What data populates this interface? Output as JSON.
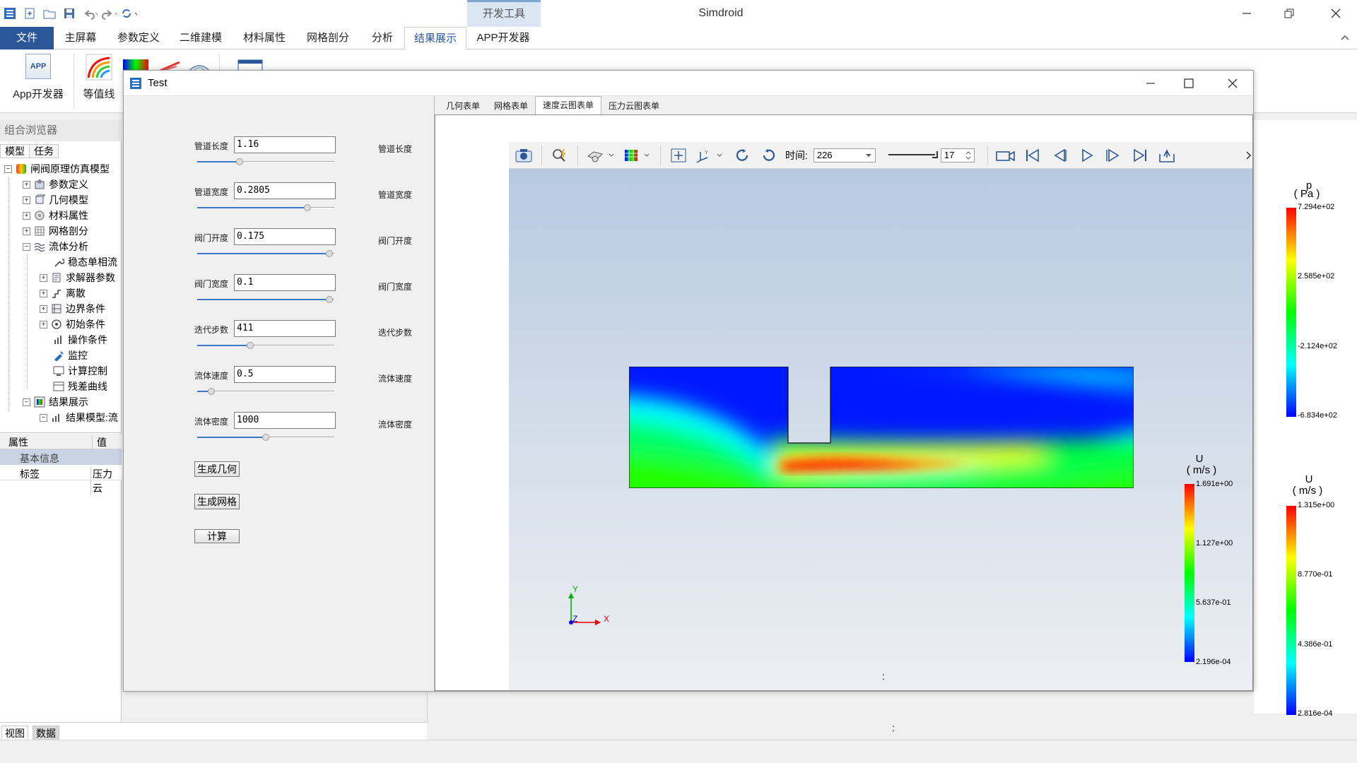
{
  "app": {
    "title": "Simdroid",
    "context_tab": "开发工具"
  },
  "ribbon": {
    "tabs": [
      "文件",
      "主屏幕",
      "参数定义",
      "二维建模",
      "材料属性",
      "网格剖分",
      "分析",
      "结果展示",
      "APP开发器"
    ],
    "active_tab": "结果展示",
    "buttons": {
      "app_dev": "App开发器",
      "contour": "等值线",
      "app_icon_text": "APP"
    }
  },
  "left_panel": {
    "header": "组合浏览器",
    "tabs": [
      "模型",
      "任务"
    ],
    "tree": [
      {
        "label": "闸阀原理仿真模型",
        "icon": "model-icon"
      },
      {
        "label": "参数定义",
        "icon": "parameter-icon"
      },
      {
        "label": "几何模型",
        "icon": "geometry-icon"
      },
      {
        "label": "材料属性",
        "icon": "material-icon"
      },
      {
        "label": "网格剖分",
        "icon": "mesh-icon"
      },
      {
        "label": "流体分析",
        "icon": "fluid-icon"
      },
      {
        "label": "稳态单相流",
        "icon": "wrench-icon"
      },
      {
        "label": "求解器参数",
        "icon": "solver-icon"
      },
      {
        "label": "离散",
        "icon": "discrete-icon"
      },
      {
        "label": "边界条件",
        "icon": "boundary-icon"
      },
      {
        "label": "初始条件",
        "icon": "initial-icon"
      },
      {
        "label": "操作条件",
        "icon": "operation-icon"
      },
      {
        "label": "监控",
        "icon": "monitor-icon"
      },
      {
        "label": "计算控制",
        "icon": "compute-icon"
      },
      {
        "label": "残差曲线",
        "icon": "residual-icon"
      },
      {
        "label": "结果展示",
        "icon": "result-icon"
      },
      {
        "label": "结果模型:流",
        "icon": "result-model-icon"
      }
    ],
    "props": {
      "col_prop": "属性",
      "col_value": "值",
      "group": "基本信息",
      "row_label": "标签",
      "row_value": "压力云"
    },
    "bottom_tabs": [
      "视图",
      "数据"
    ]
  },
  "dialog": {
    "title": "Test",
    "fields": [
      {
        "label": "管道长度",
        "value": "1.16",
        "right": "管道长度",
        "slider": 0.3
      },
      {
        "label": "管道宽度",
        "value": "0.2805",
        "right": "管道宽度",
        "slider": 0.82
      },
      {
        "label": "阀门开度",
        "value": "0.175",
        "right": "阀门开度",
        "slider": 0.99
      },
      {
        "label": "阀门宽度",
        "value": "0.1",
        "right": "阀门宽度",
        "slider": 0.99
      },
      {
        "label": "迭代步数",
        "value": "411",
        "right": "迭代步数",
        "slider": 0.38
      },
      {
        "label": "流体速度",
        "value": "0.5",
        "right": "流体速度",
        "slider": 0.08
      },
      {
        "label": "流体密度",
        "value": "1000",
        "right": "流体密度",
        "slider": 0.5
      }
    ],
    "buttons": [
      "生成几何",
      "生成网格",
      "计算"
    ],
    "tabs": [
      "几何表单",
      "网格表单",
      "速度云图表单",
      "压力云图表单"
    ],
    "active_tab": "速度云图表单"
  },
  "viewer": {
    "time_label": "时间:",
    "time_value": "226",
    "frame_value": "17",
    "bottom_mark": ":",
    "axes": {
      "x": "X",
      "y": "Y",
      "z": "Z"
    },
    "legend": {
      "title": "U",
      "unit": "( m/s )",
      "ticks": [
        "1.691e+00",
        "1.127e+00",
        "5.637e-01",
        "2.196e-04"
      ]
    }
  },
  "right_legends": {
    "pressure": {
      "title": "p",
      "unit": "( Pa )",
      "ticks": [
        "7.294e+02",
        "2.585e+02",
        "-2.124e+02",
        "-6.834e+02"
      ]
    },
    "velocity": {
      "title": "U",
      "unit": "( m/s )",
      "ticks": [
        "1.315e+00",
        "8.770e-01",
        "4.386e-01",
        "2.816e-04"
      ]
    },
    "bottom_mark": ":"
  },
  "colors": {
    "accent": "#2b579a",
    "rainbow": [
      "#ff0000",
      "#ffff00",
      "#00ff00",
      "#00ffff",
      "#0000ff"
    ]
  }
}
